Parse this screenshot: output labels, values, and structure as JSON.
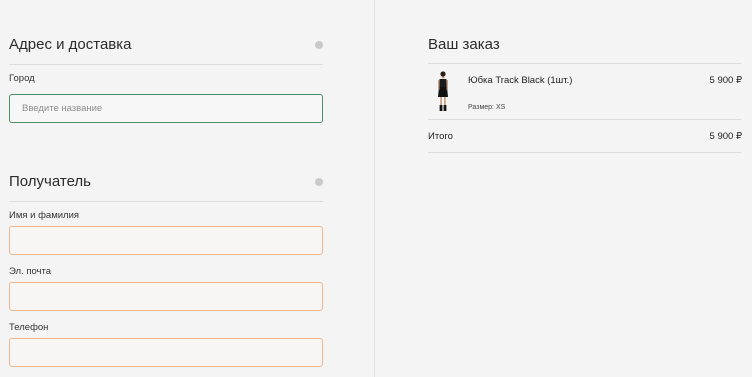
{
  "address": {
    "title": "Адрес и доставка",
    "city_label": "Город",
    "city_placeholder": "Введите название",
    "city_value": ""
  },
  "recipient": {
    "title": "Получатель",
    "name_label": "Имя и фамилия",
    "name_value": "",
    "email_label": "Эл. почта",
    "email_value": "",
    "phone_label": "Телефон",
    "phone_value": ""
  },
  "order": {
    "title": "Ваш заказ",
    "items": [
      {
        "name": "Юбка Track Black (1шт.)",
        "price": "5 900 ₽",
        "size": "Размер: XS",
        "image": "product-thumbnail-skirt"
      }
    ],
    "total_label": "Итого",
    "total_value": "5 900 ₽"
  },
  "colors": {
    "background": "#f4f4f4",
    "active_input_border": "#4c8f6a",
    "required_input_border": "#f0b48e",
    "divider": "#dcdcdc"
  }
}
